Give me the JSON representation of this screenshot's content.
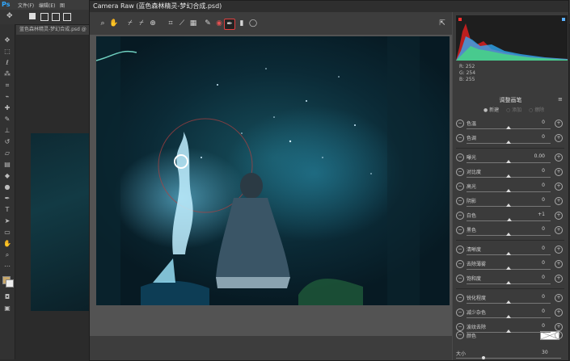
{
  "photoshop": {
    "app_logo": "Ps",
    "menu": [
      "文件(F)",
      "编辑(E)",
      "图"
    ],
    "doc_tab": "蓝色森林精灵-梦幻合成.psd @"
  },
  "camera_raw": {
    "title": "Camera Raw (蓝色森林精灵-梦幻合成.psd)",
    "histogram_readout": {
      "r": "R: 252",
      "g": "G: 254",
      "b": "B: 255"
    },
    "panel_title": "调整画笔",
    "modes": {
      "new": "新建",
      "add": "添加",
      "erase": "擦除"
    },
    "sliders": [
      {
        "label": "色温",
        "value": "0",
        "pos": 0.5
      },
      {
        "label": "色调",
        "value": "0",
        "pos": 0.5
      },
      {
        "label": "曝光",
        "value": "0.00",
        "pos": 0.5
      },
      {
        "label": "对比度",
        "value": "0",
        "pos": 0.5
      },
      {
        "label": "高光",
        "value": "0",
        "pos": 0.5
      },
      {
        "label": "阴影",
        "value": "0",
        "pos": 0.5
      },
      {
        "label": "白色",
        "value": "+1",
        "pos": 0.51
      },
      {
        "label": "黑色",
        "value": "0",
        "pos": 0.5
      },
      {
        "label": "清晰度",
        "value": "0",
        "pos": 0.5
      },
      {
        "label": "去除薄雾",
        "value": "0",
        "pos": 0.5
      },
      {
        "label": "饱和度",
        "value": "0",
        "pos": 0.5
      },
      {
        "label": "锐化程度",
        "value": "0",
        "pos": 0.5
      },
      {
        "label": "减少杂色",
        "value": "0",
        "pos": 0.5
      },
      {
        "label": "波纹去除",
        "value": "0",
        "pos": 0.5
      },
      {
        "label": "去边",
        "value": "0",
        "pos": 0.5
      }
    ],
    "color_label": "颜色",
    "size_label": "大小",
    "size_value": "30"
  }
}
